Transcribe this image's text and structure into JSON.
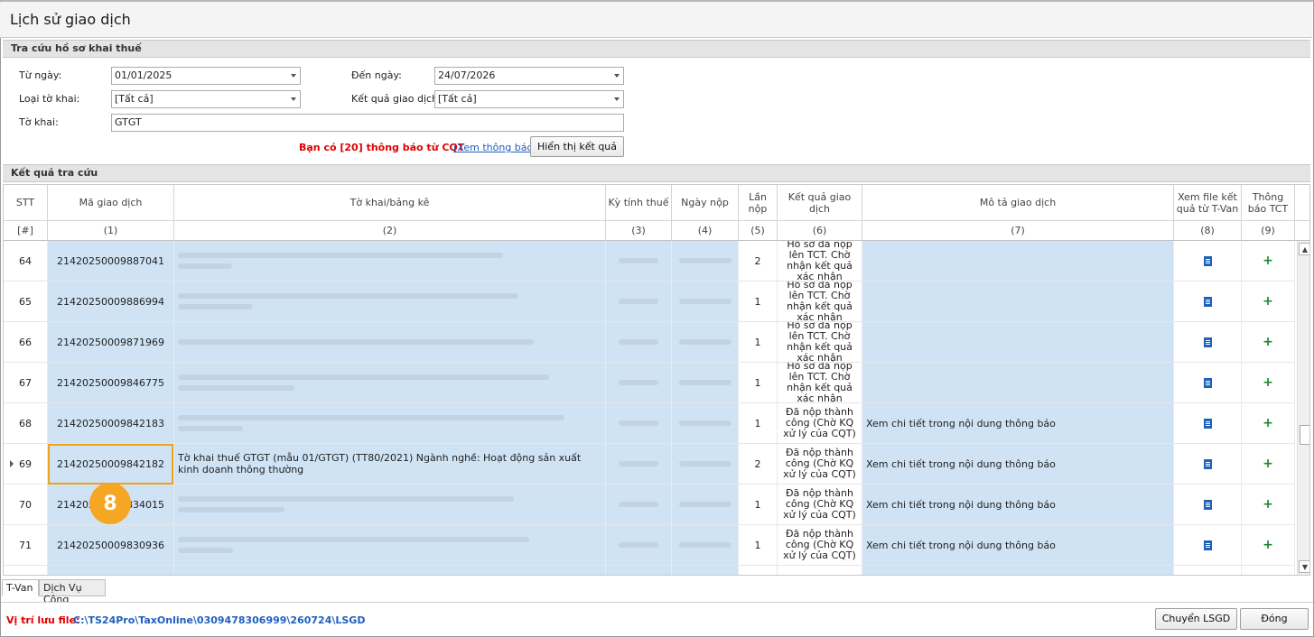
{
  "window": {
    "title": "Lịch sử giao dịch"
  },
  "search": {
    "section_title": "Tra cứu hồ sơ khai thuế",
    "from_date_label": "Từ ngày:",
    "from_date_value": "01/01/2025",
    "to_date_label": "Đến ngày:",
    "to_date_value": "24/07/2026",
    "form_type_label": "Loại tờ khai:",
    "form_type_value": "[Tất cả]",
    "result_label": "Kết quả giao dịch:",
    "result_value": "[Tất cả]",
    "form_label": "Tờ khai:",
    "form_value": "GTGT",
    "notice_text": "Bạn có [20] thông báo từ CQT",
    "notice_link": "(Xem thông báo)",
    "show_results_button": "Hiển thị kết quả"
  },
  "results": {
    "section_title": "Kết quả tra cứu",
    "columns": [
      {
        "header": "STT",
        "sub": "[#]"
      },
      {
        "header": "Mã giao dịch",
        "sub": "(1)"
      },
      {
        "header": "Tờ khai/bảng kê",
        "sub": "(2)"
      },
      {
        "header": "Kỳ tính thuế",
        "sub": "(3)"
      },
      {
        "header": "Ngày nộp",
        "sub": "(4)"
      },
      {
        "header": "Lần nộp",
        "sub": "(5)"
      },
      {
        "header": "Kết quả giao dịch",
        "sub": "(6)"
      },
      {
        "header": "Mô tả giao dịch",
        "sub": "(7)"
      },
      {
        "header": "Xem file kết quả từ T-Van",
        "sub": "(8)"
      },
      {
        "header": "Thông báo TCT",
        "sub": "(9)"
      }
    ],
    "rows": [
      {
        "stt": "64",
        "code": "21420250009887041",
        "form": "",
        "submit_count": "2",
        "result": "Hồ sơ đã nộp lên TCT. Chờ nhận kết quả xác nhận",
        "desc": ""
      },
      {
        "stt": "65",
        "code": "21420250009886994",
        "form": "",
        "submit_count": "1",
        "result": "Hồ sơ đã nộp lên TCT. Chờ nhận kết quả xác nhận",
        "desc": ""
      },
      {
        "stt": "66",
        "code": "21420250009871969",
        "form": "",
        "submit_count": "1",
        "result": "Hồ sơ đã nộp lên TCT. Chờ nhận kết quả xác nhận",
        "desc": ""
      },
      {
        "stt": "67",
        "code": "21420250009846775",
        "form": "",
        "submit_count": "1",
        "result": "Hồ sơ đã nộp lên TCT. Chờ nhận kết quả xác nhận",
        "desc": ""
      },
      {
        "stt": "68",
        "code": "21420250009842183",
        "form": "",
        "submit_count": "1",
        "result": "Đã nộp thành công (Chờ KQ xử lý của CQT)",
        "desc": "Xem chi tiết trong nội dung thông báo"
      },
      {
        "stt": "69",
        "code": "21420250009842182",
        "form": "Tờ khai thuế GTGT (mẫu 01/GTGT) (TT80/2021) Ngành nghề: Hoạt động sản xuất kinh doanh thông thường",
        "submit_count": "2",
        "result": "Đã nộp thành công (Chờ KQ xử lý của CQT)",
        "desc": "Xem chi tiết trong nội dung thông báo"
      },
      {
        "stt": "70",
        "code": "21420250009834015",
        "form": "",
        "submit_count": "1",
        "result": "Đã nộp thành công (Chờ KQ xử lý của CQT)",
        "desc": "Xem chi tiết trong nội dung thông báo"
      },
      {
        "stt": "71",
        "code": "21420250009830936",
        "form": "",
        "submit_count": "1",
        "result": "Đã nộp thành công (Chờ KQ xử lý của CQT)",
        "desc": "Xem chi tiết trong nội dung thông báo"
      },
      {
        "stt": "",
        "code": "",
        "form": "",
        "submit_count": "",
        "result": "Đã nộp thành",
        "desc": ""
      }
    ],
    "icons": {
      "file": "document-icon",
      "notice": "plus-icon"
    }
  },
  "annotation": {
    "badge": "8"
  },
  "tabs": [
    "T-Van",
    "Dịch Vụ Công"
  ],
  "footer": {
    "path_label": "Vị trí lưu file:",
    "path_value": "C:\\TS24Pro\\TaxOnline\\0309478306999\\260724\\LSGD",
    "move_button": "Chuyển LSGD",
    "close_button": "Đóng"
  }
}
